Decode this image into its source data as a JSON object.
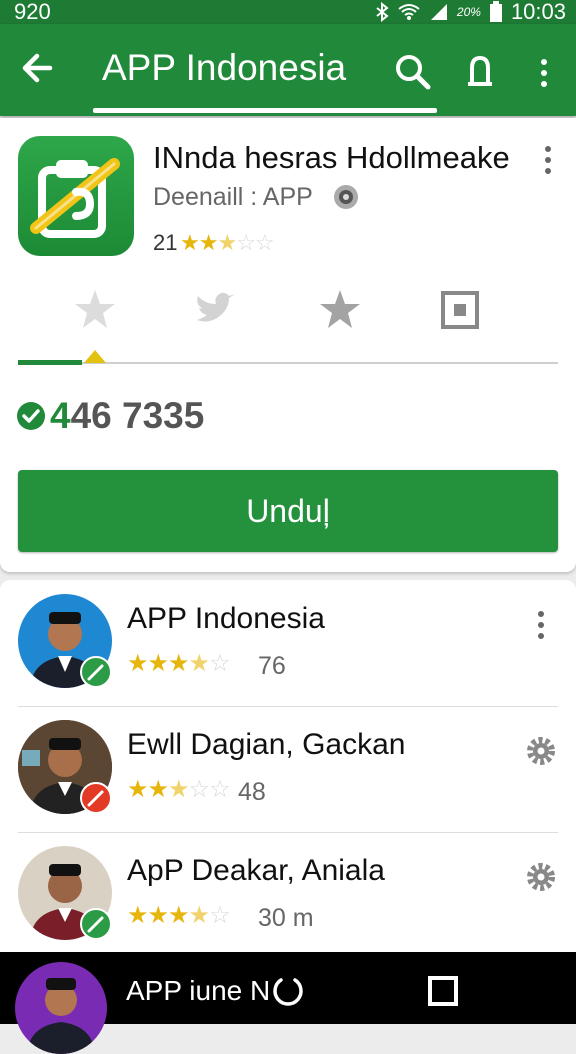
{
  "status_bar": {
    "left_text": "920",
    "battery_pct": "20%",
    "time": "10:03"
  },
  "toolbar": {
    "title": "APP Indonesia"
  },
  "app": {
    "title": "INnda hesras Hdollmeake",
    "developer": "Deenaill : APP",
    "rating_count": "21",
    "rating_stars": 2.5,
    "downloads_check": "4",
    "downloads_rest": "46 7335",
    "install_label": "Unduļ"
  },
  "tabs": [
    "star-tab",
    "twitter-tab",
    "star-tab-2",
    "box-tab"
  ],
  "list": [
    {
      "name": "APP Indonesia",
      "rating": 3.5,
      "count": "76",
      "action": "more",
      "badge": "#2b9b45",
      "avatar_bg": "#1f88d2"
    },
    {
      "name": "Ewll Dagian, Gackan",
      "rating": 3.0,
      "count": "48",
      "action": "settings",
      "badge": "#e33a26",
      "avatar_bg": "#4a3a2a"
    },
    {
      "name": "ApP Deakar, Aniala",
      "rating": 4.0,
      "count": "30 m",
      "action": "settings",
      "badge": "#2b9b45",
      "avatar_bg": "#d9d2c4"
    }
  ],
  "nav": {
    "label": "APP iune N"
  },
  "colors": {
    "accent": "#21893a",
    "star": "#e7b60c"
  }
}
